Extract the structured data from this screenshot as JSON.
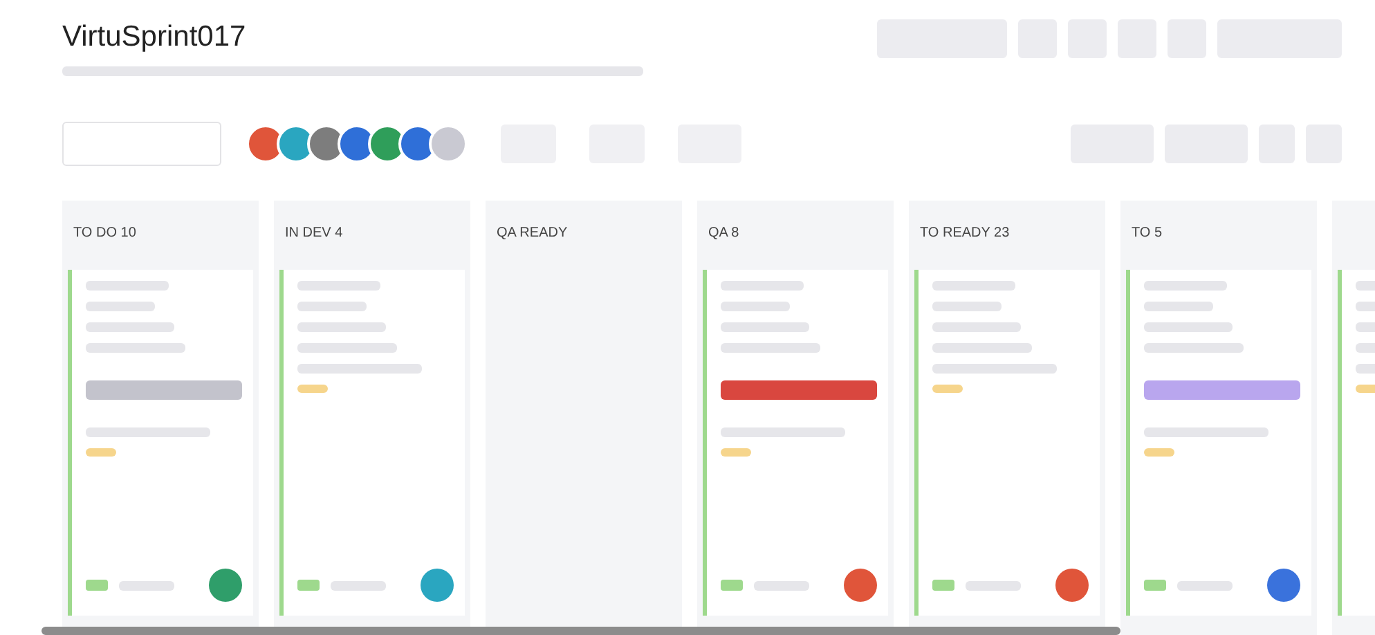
{
  "board": {
    "title": "VirtuSprint017"
  },
  "toolbar": {
    "avatars": [
      {
        "color": "#e0553a"
      },
      {
        "color": "#2aa6c0"
      },
      {
        "color": "#7d7d7d"
      },
      {
        "color": "#2f6fd8"
      },
      {
        "color": "#2f9e5a"
      },
      {
        "color": "#2f6fd8"
      },
      {
        "color": "#c9c9d2"
      }
    ]
  },
  "columns": [
    {
      "title": "TO DO 10",
      "cards": [
        {
          "kind": "task",
          "tag": {
            "color": "#c3c3cc"
          },
          "assignee": {
            "color": "#2f9e6a"
          }
        }
      ]
    },
    {
      "title": "IN DEV 4",
      "cards": [
        {
          "kind": "task",
          "assignee": {
            "color": "#2aa6c0"
          }
        }
      ]
    },
    {
      "title": "QA READY"
    },
    {
      "title": "QA 8",
      "cards": [
        {
          "kind": "task",
          "tag": {
            "color": "#d9473f"
          },
          "assignee": {
            "color": "#e0553a"
          }
        }
      ]
    },
    {
      "title": "TO READY 23",
      "cards": [
        {
          "kind": "task",
          "assignee": {
            "color": "#e0553a"
          }
        }
      ]
    },
    {
      "title": "TO 5",
      "cards": [
        {
          "kind": "task",
          "tag": {
            "color": "#b9a6ee"
          },
          "assignee": {
            "color": "#3a72dc"
          }
        }
      ]
    },
    {
      "cards": [
        {
          "kind": "task"
        }
      ]
    }
  ]
}
